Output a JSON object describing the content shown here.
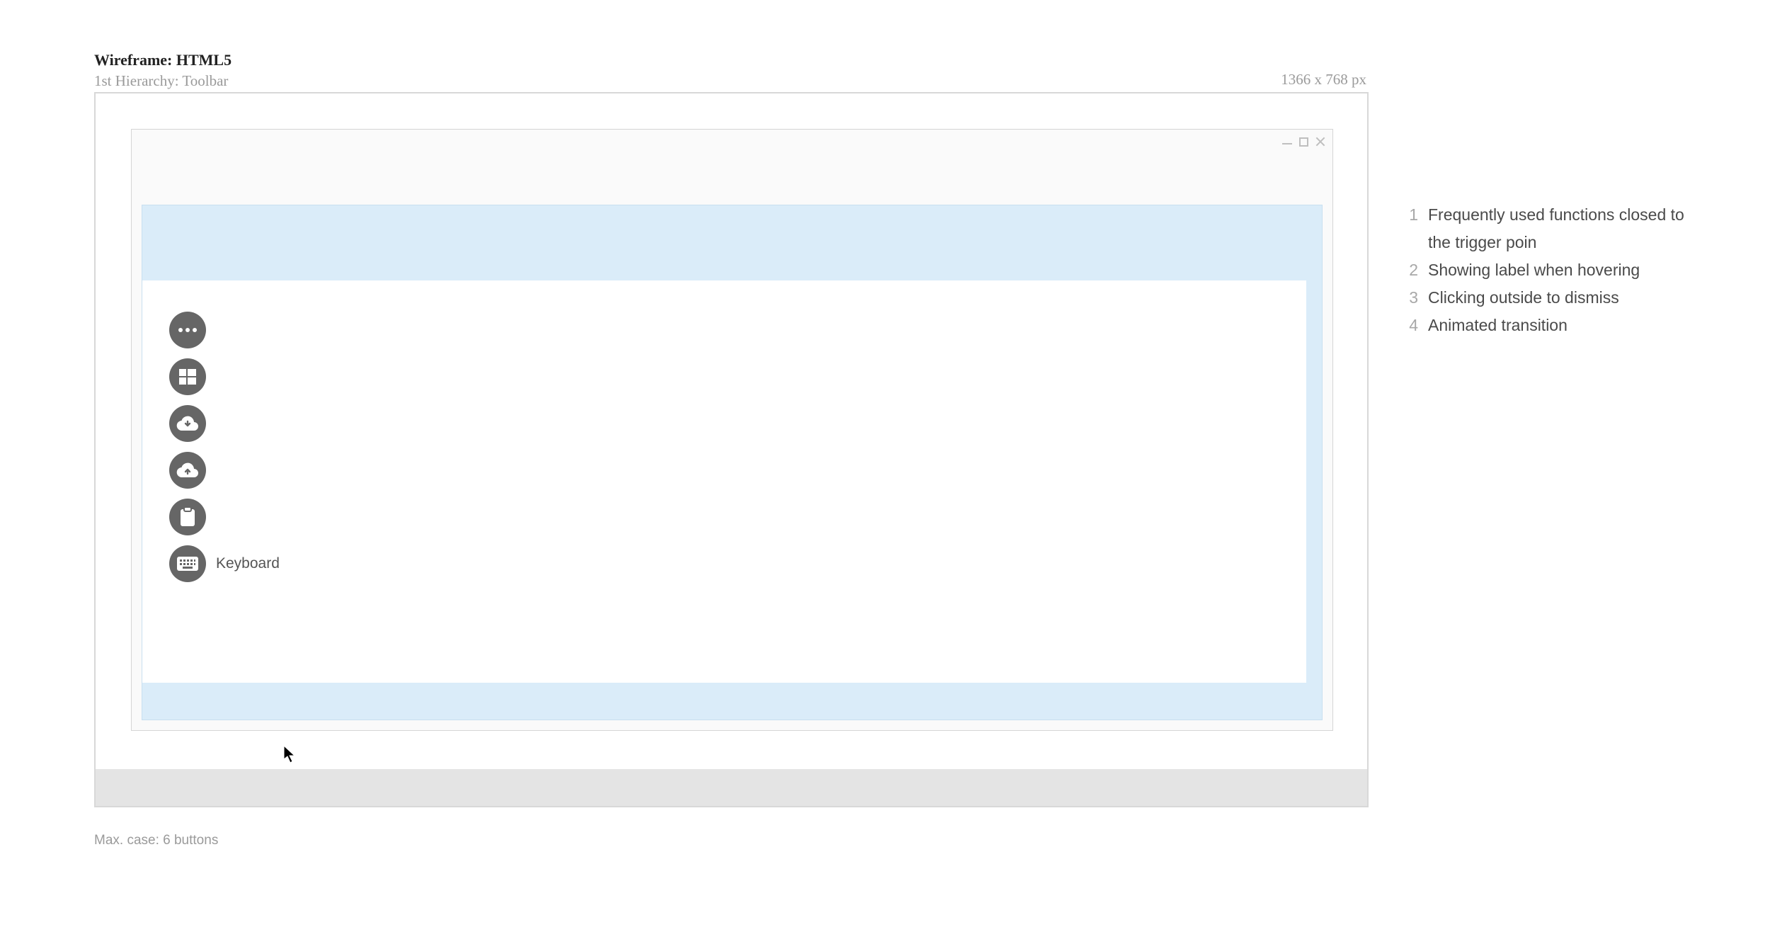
{
  "header": {
    "title_prefix": "Wireframe: ",
    "title_suffix": "HTML5",
    "subtitle": "1st Hierarchy: Toolbar",
    "dimensions": "1366 x 768 px"
  },
  "toolbar": {
    "items": [
      {
        "name": "more",
        "label": "More"
      },
      {
        "name": "windows",
        "label": "Windows"
      },
      {
        "name": "download",
        "label": "Download"
      },
      {
        "name": "upload",
        "label": "Upload"
      },
      {
        "name": "clipboard",
        "label": "Clipboard"
      },
      {
        "name": "keyboard",
        "label": "Keyboard"
      }
    ],
    "hovered_index": 5,
    "tooltip_text": "Keyboard"
  },
  "annotations": [
    "Frequently used functions closed to the trigger poin",
    "Showing label when hovering",
    "Clicking outside to dismiss",
    "Animated transition"
  ],
  "footer_note": "Max. case: 6 buttons"
}
